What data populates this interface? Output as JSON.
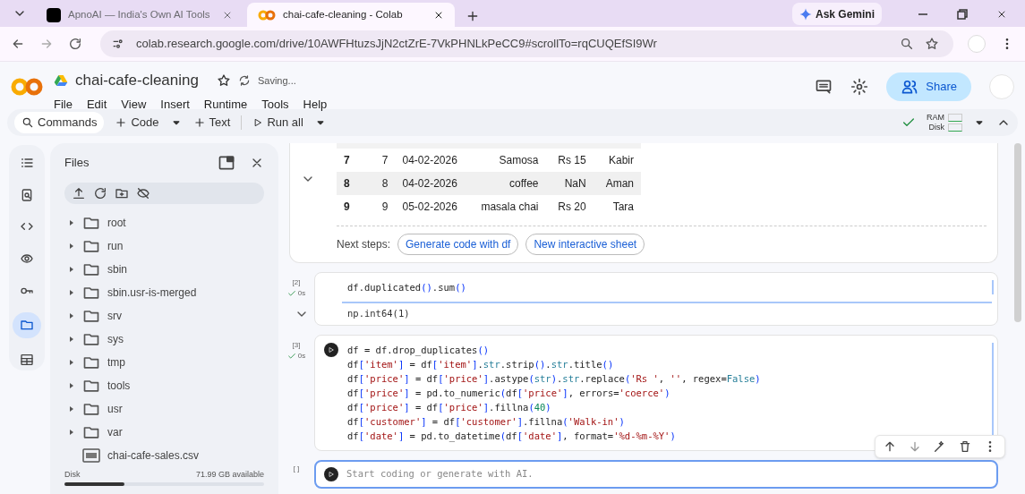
{
  "browser": {
    "tabs": [
      {
        "title": "ApnoAI — India's Own AI Tools",
        "selected": false
      },
      {
        "title": "chai-cafe-cleaning - Colab",
        "selected": true
      }
    ],
    "ask_button": "Ask Gemini",
    "url": "colab.research.google.com/drive/10AWFHtuzsJjN2ctZrE-7VkPHNLkPeCC9#scrollTo=rqCUQEfSI9Wr"
  },
  "notebook": {
    "title": "chai-cafe-cleaning",
    "save_status": "Saving...",
    "menu": [
      "File",
      "Edit",
      "View",
      "Insert",
      "Runtime",
      "Tools",
      "Help"
    ],
    "share": "Share"
  },
  "toolbar": {
    "commands": "Commands",
    "add_code": "Code",
    "add_text": "Text",
    "run_all": "Run all",
    "ram": "RAM",
    "disk": "Disk"
  },
  "sidebar": {
    "rail": [
      {
        "selected": false
      },
      {
        "selected": false
      },
      {
        "selected": false
      },
      {
        "selected": false
      },
      {
        "selected": false
      },
      {
        "selected": true
      },
      {
        "selected": false
      }
    ],
    "panel_title": "Files",
    "items": [
      {
        "name": "root",
        "kind": "folder"
      },
      {
        "name": "run",
        "kind": "folder"
      },
      {
        "name": "sbin",
        "kind": "folder"
      },
      {
        "name": "sbin.usr-is-merged",
        "kind": "folder"
      },
      {
        "name": "srv",
        "kind": "folder"
      },
      {
        "name": "sys",
        "kind": "folder"
      },
      {
        "name": "tmp",
        "kind": "folder"
      },
      {
        "name": "tools",
        "kind": "folder"
      },
      {
        "name": "usr",
        "kind": "folder"
      },
      {
        "name": "var",
        "kind": "folder"
      },
      {
        "name": "chai-cafe-sales.csv",
        "kind": "csv"
      }
    ],
    "disk_label": "Disk",
    "disk_free": "71.99 GB available",
    "disk_usage": {
      "level": 0.3
    }
  },
  "output_table": {
    "rows": [
      {
        "cells": [
          "7",
          "7",
          "04-02-2026",
          "Samosa",
          "Rs 15",
          "Kabir"
        ]
      },
      {
        "cells": [
          "8",
          "8",
          "04-02-2026",
          "coffee",
          "NaN",
          "Aman"
        ]
      },
      {
        "cells": [
          "9",
          "9",
          "05-02-2026",
          "masala chai",
          "Rs 20",
          "Tara"
        ]
      }
    ],
    "next_steps": "Next steps:",
    "chips": [
      "Generate code with df",
      "New interactive sheet"
    ]
  },
  "cells": [
    {
      "count": "[2]",
      "time": "0s",
      "code": [
        "df.duplicated().sum()"
      ],
      "output": "np.int64(1)"
    },
    {
      "count": "[3]",
      "time": "0s",
      "code": [
        "df = df.drop_duplicates()",
        "df['item'] = df['item'].str.strip().str.title()",
        "df['price'] = df['price'].astype(str).str.replace('Rs ', '', regex=False)",
        "df['price'] = pd.to_numeric(df['price'], errors='coerce')",
        "df['price'] = df['price'].fillna(40)",
        "df['customer'] = df['customer'].fillna('Walk-in')",
        "df['date'] = pd.to_datetime(df['date'], format='%d-%m-%Y')"
      ]
    }
  ],
  "new_cell": {
    "count": "[ ]",
    "placeholder": "Start coding or generate with AI."
  }
}
